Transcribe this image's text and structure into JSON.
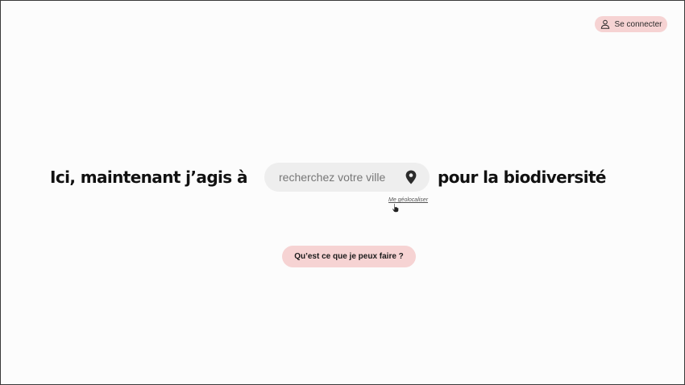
{
  "header": {
    "login_label": "Se connecter",
    "login_icon": "user-icon"
  },
  "hero": {
    "prefix": "Ici, maintenant j’agis à",
    "suffix": "pour la biodiversité"
  },
  "search": {
    "placeholder": "recherchez votre ville",
    "value": "",
    "icon": "map-pin-icon"
  },
  "geolocate_link": "Me géolocaliser",
  "cta_label": "Qu’est ce que je peux faire ?",
  "colors": {
    "accent_pink": "#f6d3d3",
    "search_bg": "#eeeeee",
    "text_dark": "#111111"
  }
}
